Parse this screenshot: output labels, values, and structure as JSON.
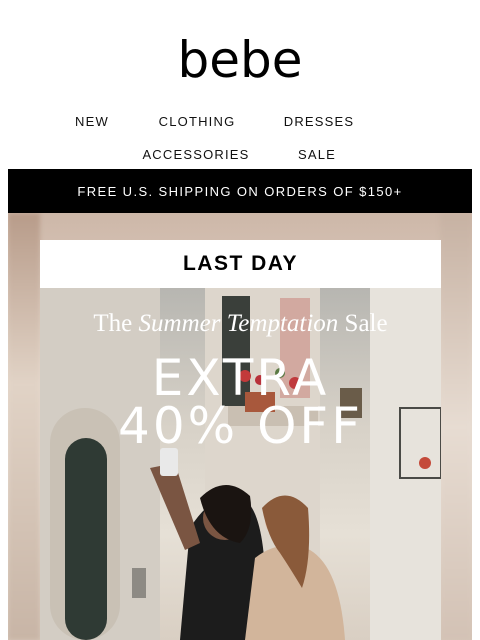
{
  "brand": {
    "logo_text": "bebe"
  },
  "nav": {
    "row1": [
      "NEW",
      "CLOTHING",
      "DRESSES"
    ],
    "row2": [
      "ACCESSORIES",
      "SALE"
    ]
  },
  "banner": {
    "text": "FREE U.S. SHIPPING ON ORDERS OF $150+"
  },
  "hero": {
    "badge": "LAST DAY",
    "headline_pre": "The ",
    "headline_em": "Summer Temptation",
    "headline_post": " Sale",
    "offer_line1": "EXTRA",
    "offer_line2": "40% OFF"
  },
  "colors": {
    "banner_bg": "#000000",
    "banner_text": "#ffffff",
    "text": "#111111"
  }
}
